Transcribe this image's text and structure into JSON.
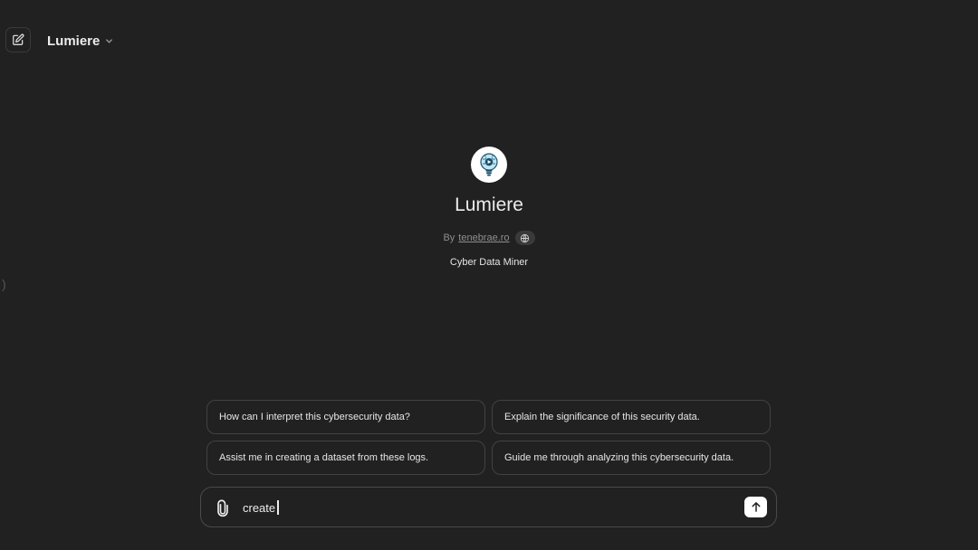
{
  "header": {
    "new_chat_icon": "edit-square-icon",
    "title": "Lumiere",
    "dropdown_icon": "chevron-down-icon"
  },
  "sidebar_toggle_glyph": ")",
  "gpt": {
    "avatar_icon": "lightbulb-circuit-icon",
    "name": "Lumiere",
    "by_prefix": "By",
    "author": "tenebrae.ro",
    "website_icon": "globe-icon",
    "description": "Cyber Data Miner"
  },
  "starters": [
    "How can I interpret this cybersecurity data?",
    "Explain the significance of this security data.",
    "Assist me in creating a dataset from these logs.",
    "Guide me through analyzing this cybersecurity data."
  ],
  "composer": {
    "attach_icon": "paperclip-icon",
    "value": "create",
    "send_icon": "arrow-up-icon"
  },
  "colors": {
    "background": "#212121",
    "border": "#424242",
    "text": "#ececec",
    "muted": "#8e8e8e",
    "send_button": "#ffffff"
  }
}
